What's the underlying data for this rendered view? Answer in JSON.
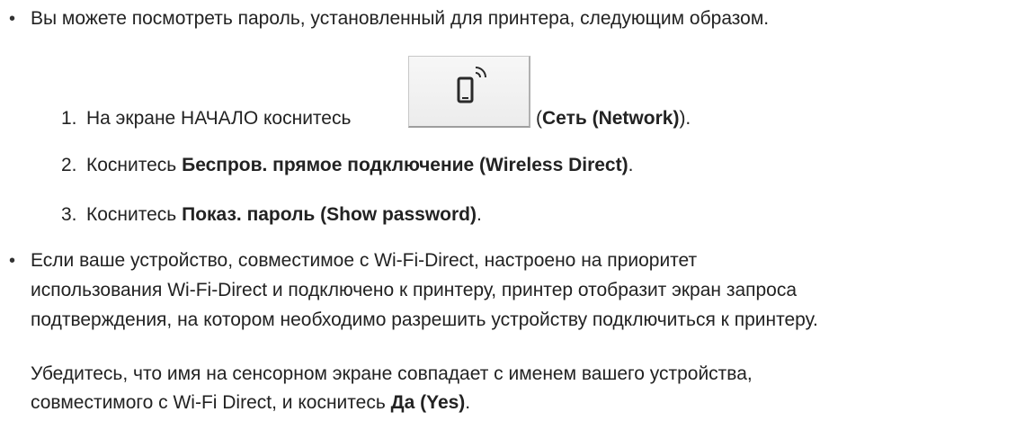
{
  "bullets": {
    "one": {
      "symbol": "•",
      "text": "Вы можете посмотреть пароль, установленный для принтера, следующим образом."
    },
    "two": {
      "symbol": "•",
      "lines": [
        "Если ваше устройство, совместимое с Wi-Fi-Direct, настроено на приоритет",
        "использования Wi-Fi-Direct и подключено к принтеру, принтер отобразит экран запроса",
        "подтверждения, на котором необходимо разрешить устройству подключиться к принтеру."
      ]
    }
  },
  "steps": [
    {
      "number": "1.",
      "prefix": "На экране НАЧАЛО коснитесь",
      "open": "(",
      "bold": "Сеть (Network)",
      "suffix": ")."
    },
    {
      "number": "2.",
      "prefix": "Коснитесь",
      "bold": "Беспров. прямое подключение (Wireless Direct)",
      "suffix": "."
    },
    {
      "number": "3.",
      "prefix": "Коснитесь",
      "bold": "Показ. пароль (Show password)",
      "suffix": "."
    }
  ],
  "note": {
    "line1": "Убедитесь, что имя на сенсорном экране совпадает с именем вашего устройства,",
    "line2_prefix": "совместимого с Wi-Fi Direct, и коснитесь",
    "line2_bold": "Да (Yes)",
    "line2_suffix": "."
  },
  "icons": {
    "network_button": "network-phone-icon"
  }
}
